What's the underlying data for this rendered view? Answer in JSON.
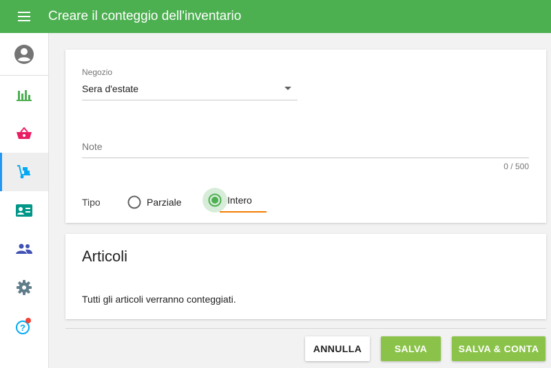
{
  "header": {
    "title": "Creare il conteggio dell'inventario",
    "menu_icon": "menu-icon"
  },
  "sidebar": {
    "items": [
      {
        "name": "account",
        "icon": "account-circle-icon",
        "color": "#757575",
        "active": false
      },
      {
        "name": "reports",
        "icon": "bar-chart-icon",
        "color": "#4caf50",
        "active": false
      },
      {
        "name": "sales",
        "icon": "basket-icon",
        "color": "#e91e63",
        "active": false
      },
      {
        "name": "inventory",
        "icon": "dolly-icon",
        "color": "#03a9f4",
        "active": true
      },
      {
        "name": "customers",
        "icon": "contact-card-icon",
        "color": "#009688",
        "active": false
      },
      {
        "name": "employees",
        "icon": "people-icon",
        "color": "#3f51b5",
        "active": false
      },
      {
        "name": "settings",
        "icon": "gear-icon",
        "color": "#607d8b",
        "active": false
      },
      {
        "name": "help",
        "icon": "help-icon",
        "color": "#03a9f4",
        "active": false,
        "notification_dot_color": "#f44336"
      }
    ]
  },
  "form": {
    "store": {
      "label": "Negozio",
      "value": "Sera d'estate"
    },
    "note": {
      "placeholder": "Note",
      "counter": "0 / 500"
    },
    "type": {
      "label": "Tipo",
      "options": [
        {
          "label": "Parziale",
          "selected": false
        },
        {
          "label": "Intero",
          "selected": true
        }
      ]
    }
  },
  "items_section": {
    "title": "Articoli",
    "text": "Tutti gli articoli verranno conteggiati."
  },
  "actions": {
    "cancel": "ANNULLA",
    "save": "SALVA",
    "save_and_count": "SALVA & CONTA"
  },
  "colors": {
    "primary": "#4caf50",
    "accent": "#8bc34a",
    "focus": "#f57c00",
    "active_indicator": "#2196f3"
  }
}
